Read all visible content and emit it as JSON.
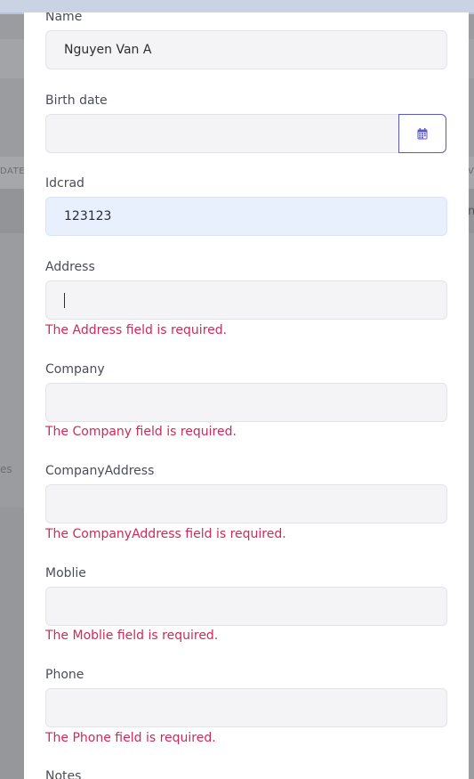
{
  "background": {
    "column_left": "DATE",
    "column_right": "V",
    "right_char": "n",
    "left_text": "es"
  },
  "form": {
    "name": {
      "label": "Name",
      "value": "Nguyen Van A"
    },
    "birth_date": {
      "label": "Birth date",
      "value": "",
      "calendar_icon": "calendar-icon"
    },
    "idcard": {
      "label": "Idcrad",
      "value": "123123"
    },
    "address": {
      "label": "Address",
      "value": "",
      "error": "The Address field is required."
    },
    "company": {
      "label": "Company",
      "value": "",
      "error": "The Company field is required."
    },
    "company_address": {
      "label": "CompanyAddress",
      "value": "",
      "error": "The CompanyAddress field is required."
    },
    "mobile": {
      "label": "Moblie",
      "value": "",
      "error": "The Moblie field is required."
    },
    "phone": {
      "label": "Phone",
      "value": "",
      "error": "The Phone field is required."
    },
    "notes": {
      "label": "Notes"
    }
  },
  "colors": {
    "error": "#d0285a",
    "accent": "#5a57c9",
    "input_bg": "#f4f4f6",
    "autofill_bg": "#e8f0fd"
  }
}
